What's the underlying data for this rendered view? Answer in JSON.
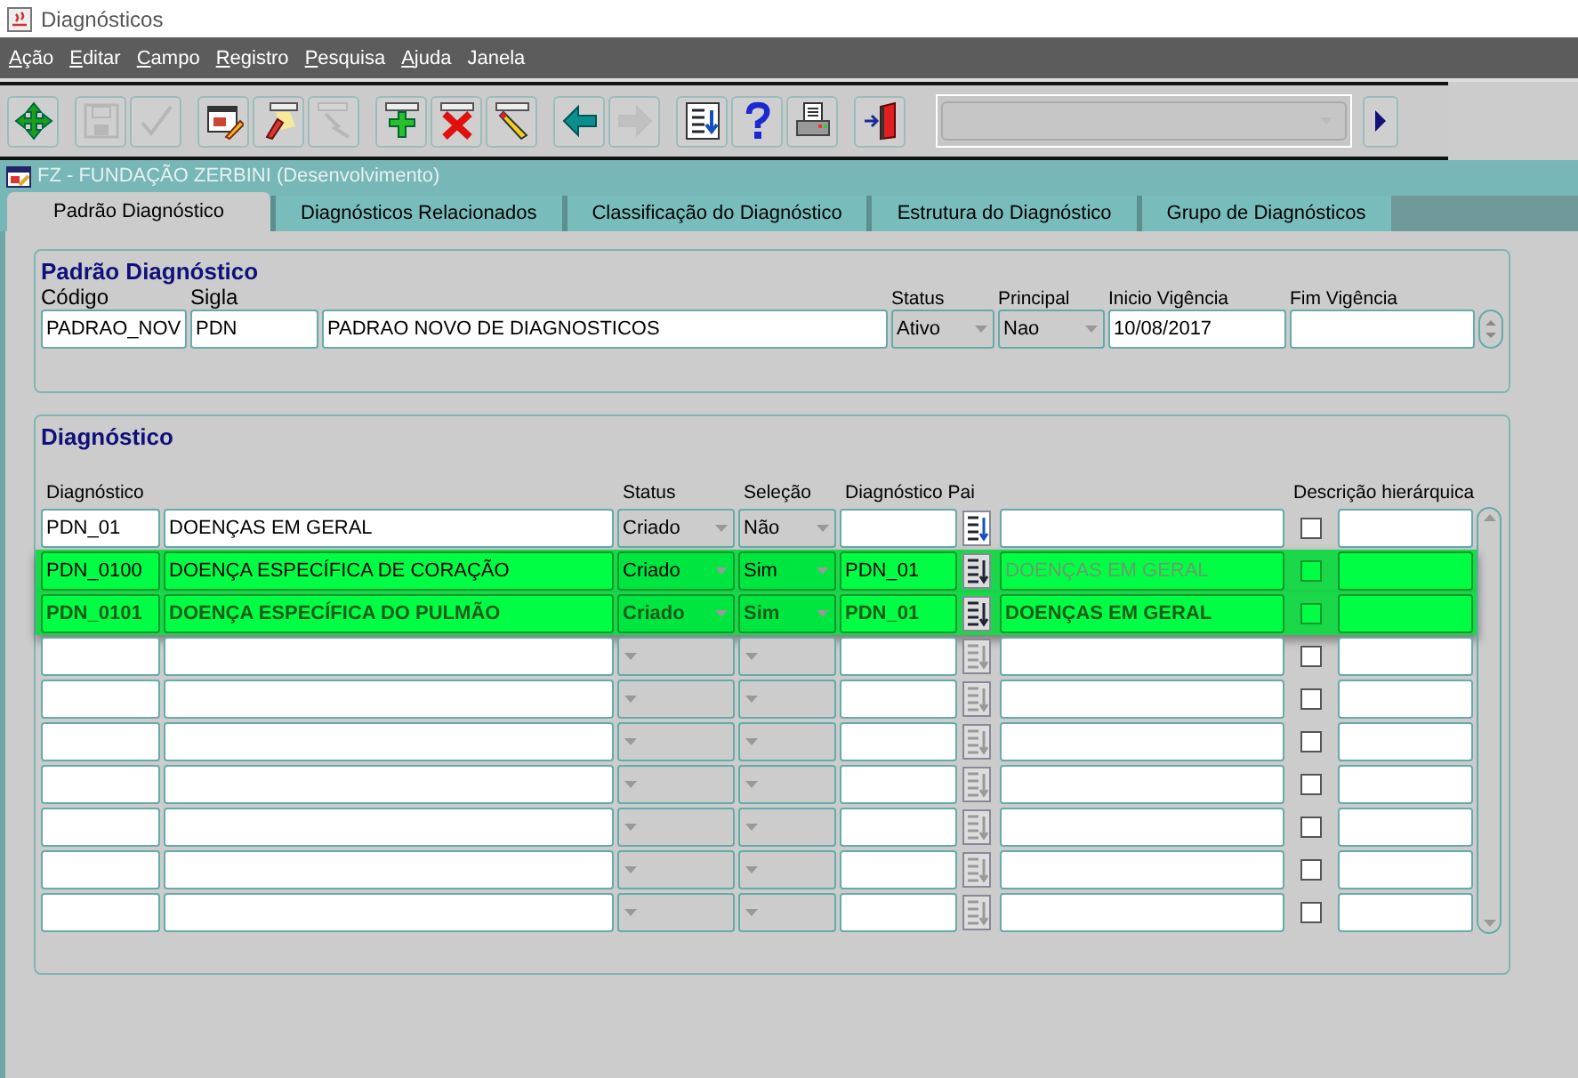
{
  "window": {
    "title": "Diagnósticos"
  },
  "menu": [
    {
      "label": "Ação",
      "underline_first": true
    },
    {
      "label": "Editar",
      "underline_first": true
    },
    {
      "label": "Campo",
      "underline_first": true
    },
    {
      "label": "Registro",
      "underline_first": true
    },
    {
      "label": "Pesquisa",
      "underline_first": true
    },
    {
      "label": "Ajuda",
      "underline_first": true
    },
    {
      "label": "Janela",
      "underline_first": false
    }
  ],
  "toolbar_groups": [
    [
      {
        "kind": "move",
        "disabled": false
      }
    ],
    [
      {
        "kind": "save",
        "disabled": true
      },
      {
        "kind": "accept",
        "disabled": true
      }
    ],
    [
      {
        "kind": "form",
        "disabled": false
      },
      {
        "kind": "flashlight",
        "disabled": false
      },
      {
        "kind": "query",
        "disabled": true
      }
    ],
    [
      {
        "kind": "add",
        "disabled": false
      },
      {
        "kind": "delete",
        "disabled": false
      },
      {
        "kind": "pen",
        "disabled": false
      }
    ],
    [
      {
        "kind": "back",
        "disabled": false
      },
      {
        "kind": "forward",
        "disabled": true
      }
    ],
    [
      {
        "kind": "list",
        "disabled": false
      },
      {
        "kind": "help",
        "disabled": false
      },
      {
        "kind": "print",
        "disabled": false
      }
    ],
    [
      {
        "kind": "exit",
        "disabled": false
      }
    ]
  ],
  "form_title": "FZ - FUNDAÇÃO ZERBINI (Desenvolvimento)",
  "tabs": [
    {
      "label": "Padrão Diagnóstico",
      "selected": true
    },
    {
      "label": "Diagnósticos Relacionados",
      "selected": false
    },
    {
      "label": "Classificação do Diagnóstico",
      "selected": false
    },
    {
      "label": "Estrutura do Diagnóstico",
      "selected": false
    },
    {
      "label": "Grupo de Diagnósticos",
      "selected": false
    }
  ],
  "header_panel": {
    "title": "Padrão Diagnóstico",
    "labels": {
      "code": "Código",
      "abbr": "Sigla",
      "status": "Status",
      "principal": "Principal",
      "start": "Inicio Vigência",
      "end": "Fim Vigência"
    },
    "values": {
      "code": "PADRAO_NOV",
      "abbr": "PDN",
      "description": "PADRAO NOVO DE DIAGNOSTICOS",
      "status": "Ativo",
      "principal": "Nao",
      "start": "10/08/2017"
    }
  },
  "diagnosis_panel": {
    "title": "Diagnóstico",
    "columns": {
      "code": "Diagnóstico",
      "status": "Status",
      "selection": "Seleção",
      "parent": "Diagnóstico Pai",
      "hierarchy": "Descrição hierárquica"
    },
    "rows": [
      {
        "kind": "record",
        "code": "PDN_01",
        "description": "DOENÇAS EM GERAL",
        "status": "Criado",
        "selection": "Não",
        "highlighted": false,
        "bold": false,
        "checked": false
      },
      {
        "kind": "record",
        "code": "PDN_0100",
        "description": "DOENÇA ESPECÍFICA DE CORAÇÃO",
        "status": "Criado",
        "selection": "Sim",
        "parent_code": "PDN_01",
        "parent_description": "DOENÇAS EM GERAL",
        "highlighted": true,
        "bold": false,
        "parent_dimmed": true,
        "checked": false
      },
      {
        "kind": "record",
        "code": "PDN_0101",
        "description": "DOENÇA ESPECÍFICA DO PULMÃO",
        "status": "Criado",
        "selection": "Sim",
        "parent_code": "PDN_01",
        "parent_description": "DOENÇAS EM GERAL",
        "highlighted": true,
        "bold": true,
        "parent_dimmed": false,
        "checked": false
      },
      {
        "kind": "blank",
        "checked": false
      },
      {
        "kind": "blank",
        "checked": false
      },
      {
        "kind": "blank",
        "checked": false
      },
      {
        "kind": "blank",
        "checked": false
      },
      {
        "kind": "blank",
        "checked": false
      },
      {
        "kind": "blank",
        "checked": false
      },
      {
        "kind": "blank",
        "checked": false
      }
    ]
  }
}
